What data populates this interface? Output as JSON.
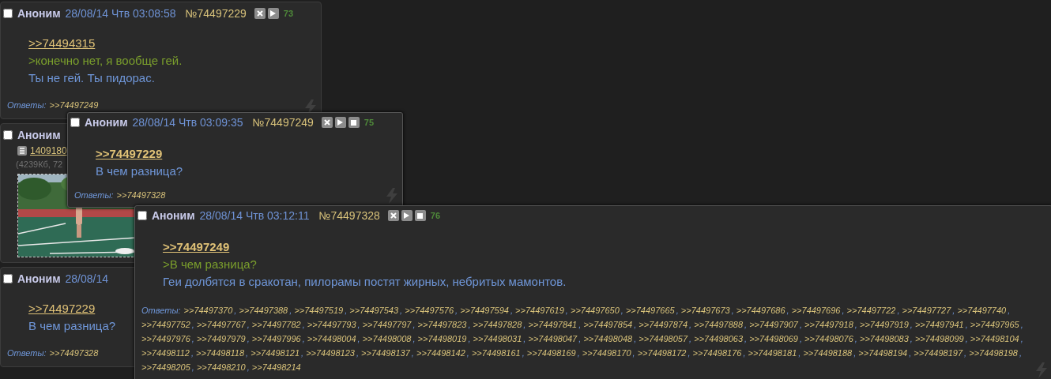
{
  "thread": [
    {
      "kind": "post",
      "checked": false,
      "name": "Аноним",
      "date": "28/08/14 Чтв 03:08:58",
      "number": "№74497229",
      "controls": [
        {
          "kind": "hide"
        },
        {
          "kind": "play"
        }
      ],
      "count": "73",
      "quote": ">>74494315",
      "quote_bold": false,
      "lines": [
        {
          "kind": "greentext",
          "text": ">конечно нет, я вообще гей."
        },
        {
          "kind": "text",
          "text": "Ты не гей. Ты пидорас."
        }
      ],
      "replies_label": "Ответы:",
      "replies": [
        ">>74497249"
      ],
      "bolt": true
    },
    {
      "kind": "file",
      "checked": false,
      "name": "Аноним",
      "file_name": "1409180",
      "file_info": "(4239Кб, 72"
    },
    {
      "kind": "post",
      "checked": false,
      "name": "Аноним",
      "date": "28/08/14",
      "quote": ">>74497229",
      "quote_bold": false,
      "lines": [
        {
          "kind": "text",
          "text": "В чем разница?"
        }
      ],
      "replies_label": "Ответы:",
      "replies": [
        ">>74497328"
      ]
    }
  ],
  "popups": [
    {
      "checked": false,
      "name": "Аноним",
      "date": "28/08/14 Чтв 03:09:35",
      "number": "№74497249",
      "controls": [
        {
          "kind": "hide"
        },
        {
          "kind": "play"
        },
        {
          "kind": "stop"
        }
      ],
      "count": "75",
      "quote": ">>74497229",
      "quote_bold": true,
      "lines": [
        {
          "kind": "text",
          "text": "В чем разница?"
        }
      ],
      "replies_label": "Ответы:",
      "replies": [
        ">>74497328"
      ]
    },
    {
      "checked": false,
      "name": "Аноним",
      "date": "28/08/14 Чтв 03:12:11",
      "number": "№74497328",
      "controls": [
        {
          "kind": "hide"
        },
        {
          "kind": "play"
        },
        {
          "kind": "stop"
        }
      ],
      "count": "76",
      "quote": ">>74497249",
      "quote_bold": true,
      "lines": [
        {
          "kind": "greentext",
          "text": ">В чем разница?"
        },
        {
          "kind": "text",
          "text": "Геи долбятся в сракотан, пилорамы постят жирных, небритых мамонтов."
        }
      ],
      "replies_label": "Ответы:",
      "separator": ",",
      "replies": [
        ">>74497370",
        ">>74497388",
        ">>74497519",
        ">>74497543",
        ">>74497576",
        ">>74497594",
        ">>74497619",
        ">>74497650",
        ">>74497665",
        ">>74497673",
        ">>74497686",
        ">>74497696",
        ">>74497722",
        ">>74497727",
        ">>74497740",
        ">>74497752",
        ">>74497767",
        ">>74497782",
        ">>74497793",
        ">>74497797",
        ">>74497823",
        ">>74497828",
        ">>74497841",
        ">>74497854",
        ">>74497874",
        ">>74497888",
        ">>74497907",
        ">>74497918",
        ">>74497919",
        ">>74497941",
        ">>74497965",
        ">>74497976",
        ">>74497979",
        ">>74497996",
        ">>74498004",
        ">>74498008",
        ">>74498019",
        ">>74498031",
        ">>74498047",
        ">>74498048",
        ">>74498057",
        ">>74498063",
        ">>74498069",
        ">>74498076",
        ">>74498083",
        ">>74498099",
        ">>74498104",
        ">>74498112",
        ">>74498118",
        ">>74498121",
        ">>74498123",
        ">>74498137",
        ">>74498142",
        ">>74498161",
        ">>74498169",
        ">>74498170",
        ">>74498172",
        ">>74498176",
        ">>74498181",
        ">>74498188",
        ">>74498194",
        ">>74498197",
        ">>74498198",
        ">>74498205",
        ">>74498210",
        ">>74498214"
      ]
    }
  ]
}
